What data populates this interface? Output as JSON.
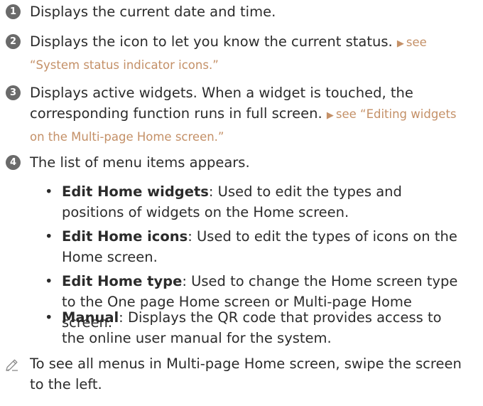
{
  "items": [
    {
      "number": "1",
      "text": "Displays the current date and time."
    },
    {
      "number": "2",
      "text": "Displays the icon to let you know the current status.",
      "link_arrow": "▶",
      "link_text": "see “System status indicator icons.”"
    },
    {
      "number": "3",
      "text": "Displays active widgets. When a widget is touched, the corresponding function runs in full screen.",
      "link_arrow": "▶",
      "link_text": "see “Editing widgets on the Multi-page Home screen.”"
    },
    {
      "number": "4",
      "text": "The list of menu items appears."
    }
  ],
  "menu_items": [
    {
      "title": "Edit Home widgets",
      "description": ": Used to edit the types and positions of widgets on the Home screen."
    },
    {
      "title": "Edit Home icons",
      "description": ": Used to edit the types of icons on the Home screen."
    },
    {
      "title": "Edit Home type",
      "description": ": Used to change the Home screen type to the One page Home screen or Multi-page Home screen."
    },
    {
      "title": "Manual",
      "description": ": Displays the QR code that provides access to the online user manual for the system."
    }
  ],
  "bullet_char": "•",
  "note": {
    "icon": "pencil-icon",
    "text": "To see all menus in Multi-page Home screen, swipe the screen to the left."
  }
}
